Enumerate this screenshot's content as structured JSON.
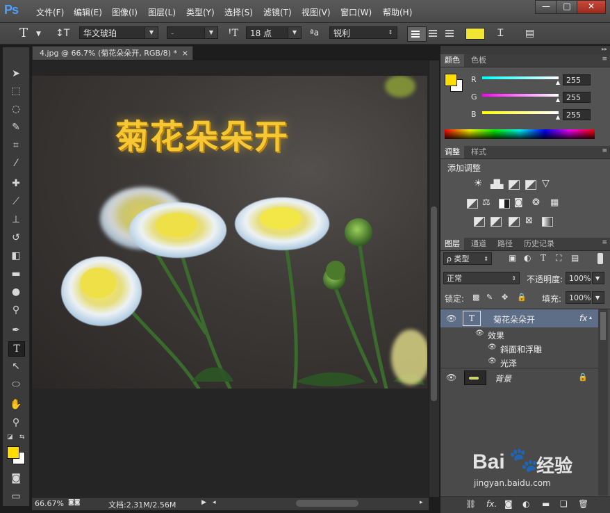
{
  "app": {
    "logo": "Ps",
    "menu": [
      "文件(F)",
      "编辑(E)",
      "图像(I)",
      "图层(L)",
      "类型(Y)",
      "选择(S)",
      "滤镜(T)",
      "视图(V)",
      "窗口(W)",
      "帮助(H)"
    ],
    "window_buttons": [
      "—",
      "□",
      "✕"
    ]
  },
  "options_bar": {
    "tool_glyph": "T",
    "font_family": "华文琥珀",
    "font_style": "-",
    "font_size": "18 点",
    "aa_label": "ªa",
    "antialias": "锐利",
    "color_swatch": "#f1e433"
  },
  "document": {
    "tab_title": "4.jpg @ 66.7% (菊花朵朵开, RGB/8) *",
    "tab_close": "×",
    "canvas_text": "菊花朵朵开"
  },
  "status": {
    "zoom": "66.67%",
    "doc_info": "文档:2.31M/2.56M"
  },
  "color_panel": {
    "tabs": [
      "颜色",
      "色板"
    ],
    "foreground": "#ffdd00",
    "background": "#ffffff",
    "channels": [
      {
        "label": "R",
        "value": "255"
      },
      {
        "label": "G",
        "value": "255"
      },
      {
        "label": "B",
        "value": "255"
      }
    ]
  },
  "adjust_panel": {
    "tabs": [
      "调整",
      "样式"
    ],
    "title": "添加调整"
  },
  "layers_panel": {
    "tabs": [
      "图层",
      "通道",
      "路径",
      "历史记录"
    ],
    "filter": "ρ 类型",
    "blend_mode": "正常",
    "opacity_label": "不透明度:",
    "opacity": "100%",
    "lock_label": "锁定:",
    "fill_label": "填充:",
    "fill": "100%",
    "layers": [
      {
        "name": "菊花朵朵开",
        "fx": "fx"
      },
      {
        "name": "背景"
      }
    ],
    "effects_label": "效果",
    "effects": [
      "斜面和浮雕",
      "光泽"
    ]
  },
  "colors": {
    "accent_yellow": "#ffdd00",
    "selected_layer": "#5d6e86"
  },
  "watermark": {
    "brand_left": "Bai",
    "brand_right": "经验",
    "site": "jingyan.baidu.com"
  }
}
